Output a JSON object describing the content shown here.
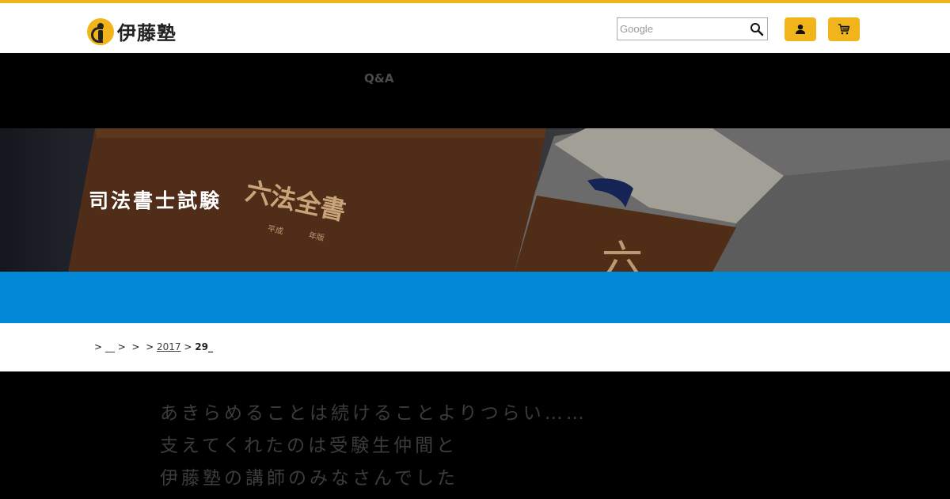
{
  "brand": {
    "logo_text": "伊藤塾",
    "accent_color": "#f2b41b",
    "primary_blue": "#0088d6"
  },
  "header": {
    "search": {
      "placeholder": "Google"
    },
    "user_icon": "user-icon",
    "cart_icon": "cart-icon"
  },
  "nav": {
    "items": [
      {
        "label": "Q&A"
      }
    ]
  },
  "hero": {
    "title": "司法書士試験",
    "book_title": "六法全書",
    "book_sub_1": "平成",
    "book_sub_2": "年版",
    "book_spine": "六"
  },
  "breadcrumb": {
    "items": [
      {
        "label": ">"
      },
      {
        "label": "__"
      },
      {
        "label": ">"
      },
      {
        "label": ">"
      },
      {
        "label": ">"
      },
      {
        "label": "2017"
      },
      {
        "label": ">"
      },
      {
        "label": "29_"
      }
    ]
  },
  "message": {
    "lines": [
      "あきらめることは続けることよりつらい……",
      "支えてくれたのは受験生仲間と",
      "伊藤塾の講師のみなさんでした"
    ]
  }
}
